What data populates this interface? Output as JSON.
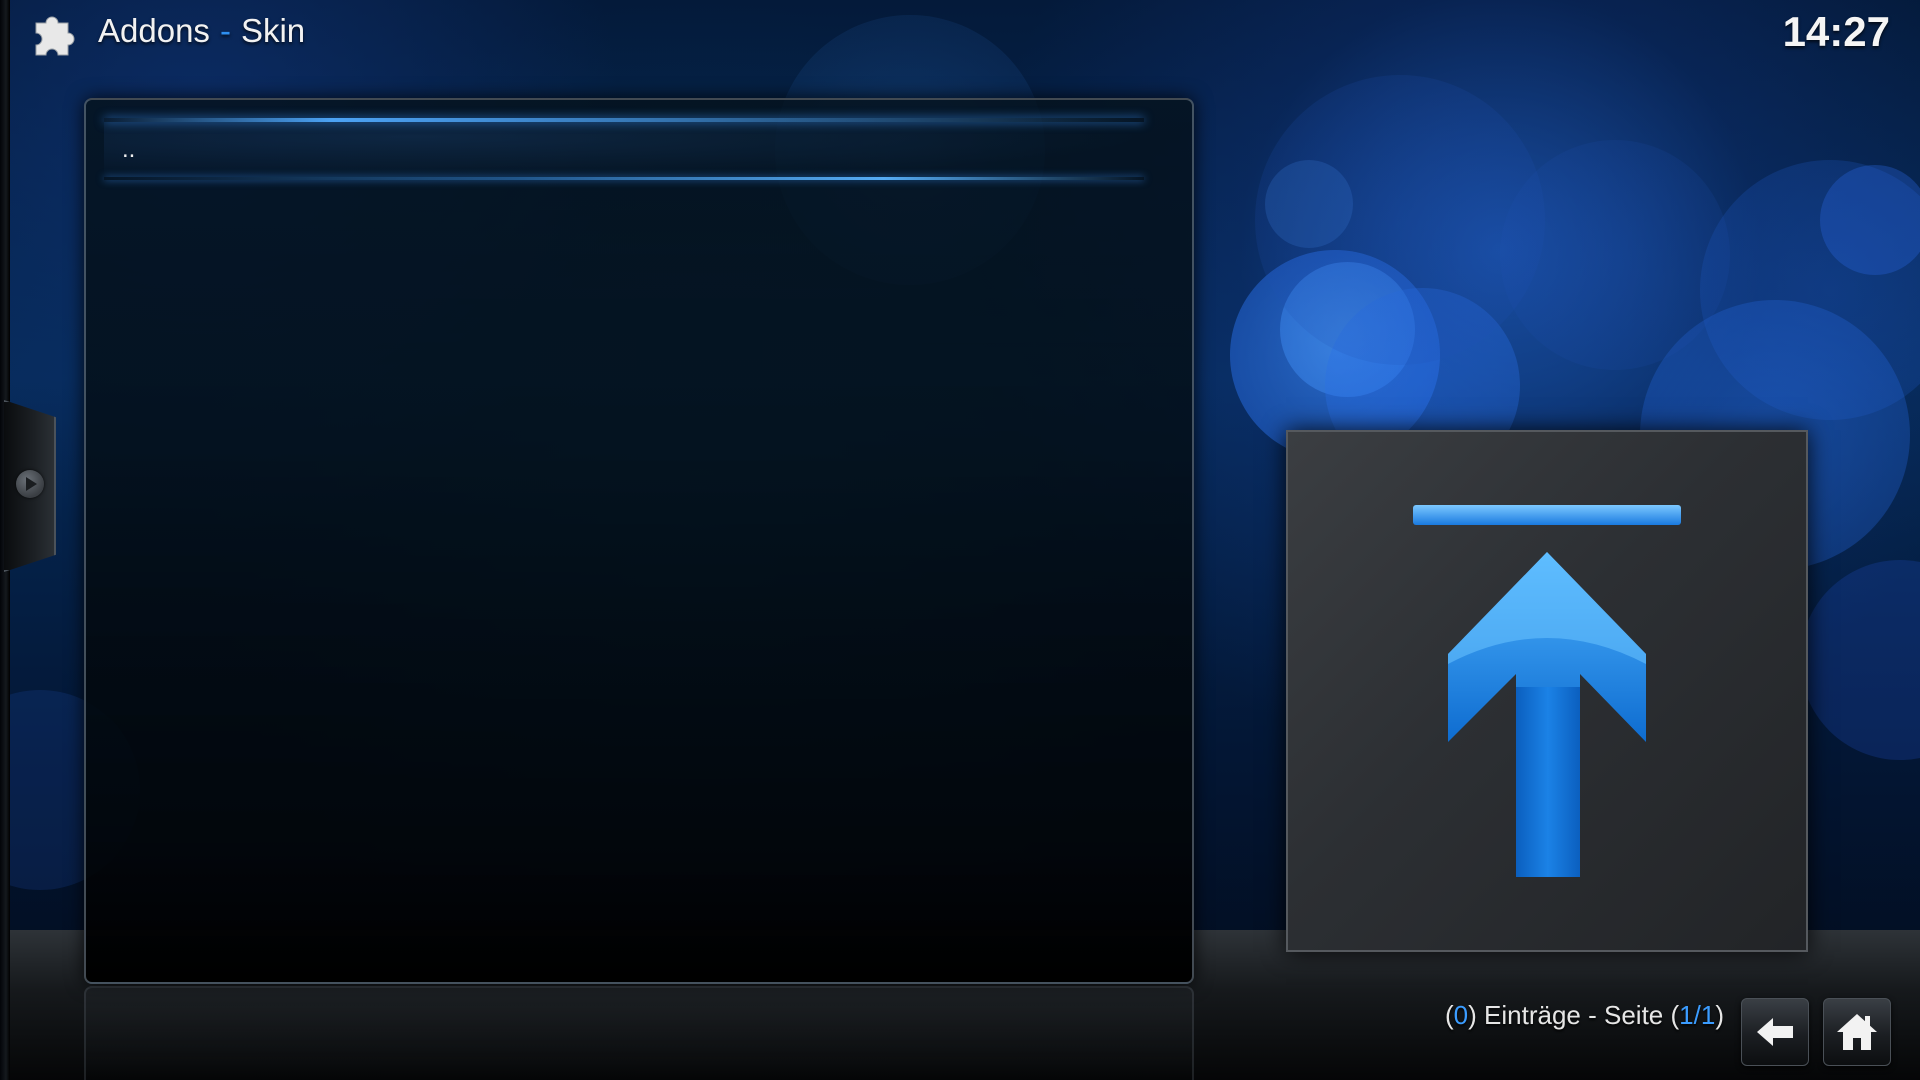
{
  "header": {
    "section": "Addons",
    "separator": "-",
    "subsection": "Skin",
    "icon": "puzzle-piece-icon"
  },
  "clock": "14:27",
  "list": {
    "items": [
      {
        "label": "..",
        "icon": "folder-up-arrow-icon"
      }
    ]
  },
  "footer": {
    "count_open": "(",
    "count": "0",
    "count_close": ")",
    "entries_label": "Einträge - Seite",
    "page_open": "(",
    "page": "1/1",
    "page_close": ")",
    "back_icon": "back-arrow-icon",
    "home_icon": "home-icon"
  },
  "colors": {
    "accent": "#2e8ff0",
    "background": "#062a58",
    "panel": "#04121c"
  }
}
